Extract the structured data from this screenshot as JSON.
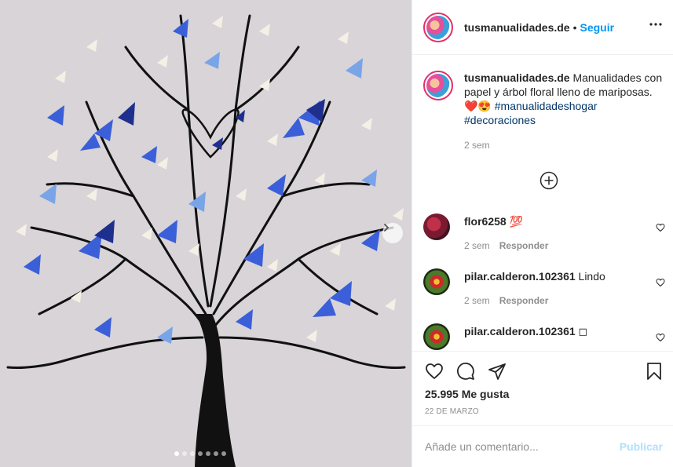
{
  "post": {
    "photo_alt": "",
    "carousel_count": 7,
    "carousel_active": 0
  },
  "header": {
    "username": "tusmanualidades.de",
    "separator": "•",
    "follow_label": "Seguir",
    "more_label": "•••"
  },
  "caption": {
    "username": "tusmanualidades.de",
    "text": " Manualidades con papel y árbol floral lleno de mariposas. ❤️😍 ",
    "tags": [
      "#manualidadeshogar",
      "#decoraciones"
    ],
    "time": "2 sem"
  },
  "comments": [
    {
      "username": "flor6258",
      "text": " 💯",
      "time": "2 sem",
      "reply_label": "Responder"
    },
    {
      "username": "pilar.calderon.102361",
      "text": " Lindo",
      "time": "2 sem",
      "reply_label": "Responder"
    },
    {
      "username": "pilar.calderon.102361",
      "text": " ◻"
    }
  ],
  "actions": {
    "likes": "25.995 Me gusta",
    "date": "22 DE MARZO"
  },
  "add_comment": {
    "placeholder": "Añade un comentario...",
    "publish_label": "Publicar"
  },
  "colors": {
    "accent": "#0095f6",
    "publish_disabled": "#b2dffc",
    "tag": "#00376b",
    "muted": "#8e8e8e"
  }
}
